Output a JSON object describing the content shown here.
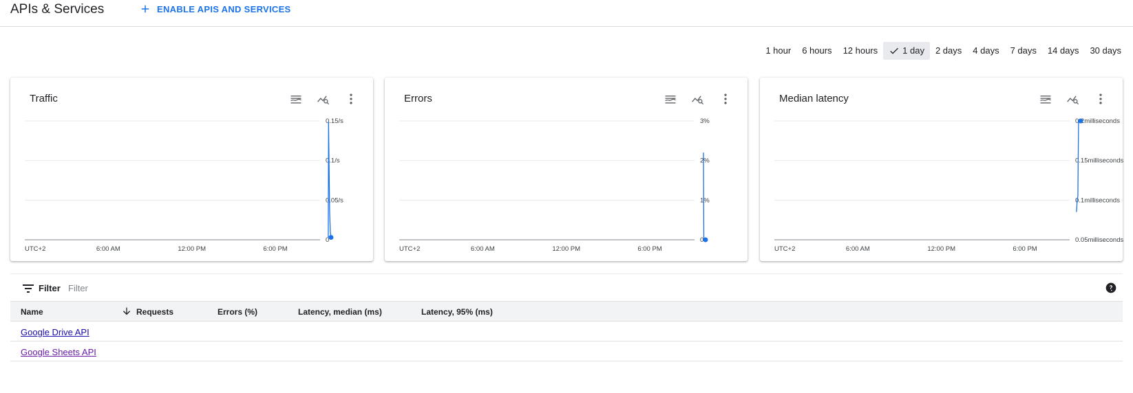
{
  "header": {
    "title": "APIs & Services",
    "enable_label": "ENABLE APIS AND SERVICES"
  },
  "time_range": {
    "options": [
      "1 hour",
      "6 hours",
      "12 hours",
      "1 day",
      "2 days",
      "4 days",
      "7 days",
      "14 days",
      "30 days"
    ],
    "selected": "1 day"
  },
  "colors": {
    "accent": "#1a73e8",
    "series": "#1a73e8",
    "link_unvisited": "#1a0dab",
    "link_visited": "#681da8"
  },
  "chart_data": [
    {
      "type": "line",
      "title": "Traffic",
      "x_ticks": [
        "UTC+2",
        "6:00 AM",
        "12:00 PM",
        "6:00 PM"
      ],
      "y_ticks": [
        "0.15/s",
        "0.1/s",
        "0.05/s",
        "0"
      ],
      "ylim": [
        0,
        0.15
      ],
      "grid": true,
      "series": [
        {
          "x": [
            21.8,
            21.82,
            21.9,
            21.95,
            22.0
          ],
          "y": [
            0.003,
            0.149,
            0.035,
            0.01,
            0.003
          ]
        }
      ]
    },
    {
      "type": "line",
      "title": "Errors",
      "x_ticks": [
        "UTC+2",
        "6:00 AM",
        "12:00 PM",
        "6:00 PM"
      ],
      "y_ticks": [
        "3%",
        "2%",
        "1%",
        "0"
      ],
      "ylim": [
        0,
        3
      ],
      "grid": true,
      "series": [
        {
          "x": [
            21.85,
            21.88,
            22.0
          ],
          "y": [
            2.2,
            0.0,
            0.0
          ]
        }
      ]
    },
    {
      "type": "line",
      "title": "Median latency",
      "x_ticks": [
        "UTC+2",
        "6:00 AM",
        "12:00 PM",
        "6:00 PM"
      ],
      "y_ticks": [
        "0.2milliseconds",
        "0.15milliseconds",
        "0.1milliseconds",
        "0.05milliseconds"
      ],
      "ylim": [
        0.05,
        0.2
      ],
      "grid": true,
      "series": [
        {
          "x": [
            21.7,
            21.75,
            21.8,
            21.85,
            22.0
          ],
          "y": [
            0.085,
            0.1,
            0.105,
            0.2,
            0.2
          ]
        }
      ]
    }
  ],
  "filter": {
    "label": "Filter",
    "placeholder": "Filter"
  },
  "table": {
    "columns": [
      "Name",
      "Requests",
      "Errors (%)",
      "Latency, median (ms)",
      "Latency, 95% (ms)"
    ],
    "rows": [
      {
        "name": "Google Drive API",
        "visited": false
      },
      {
        "name": "Google Sheets API",
        "visited": true
      }
    ]
  }
}
